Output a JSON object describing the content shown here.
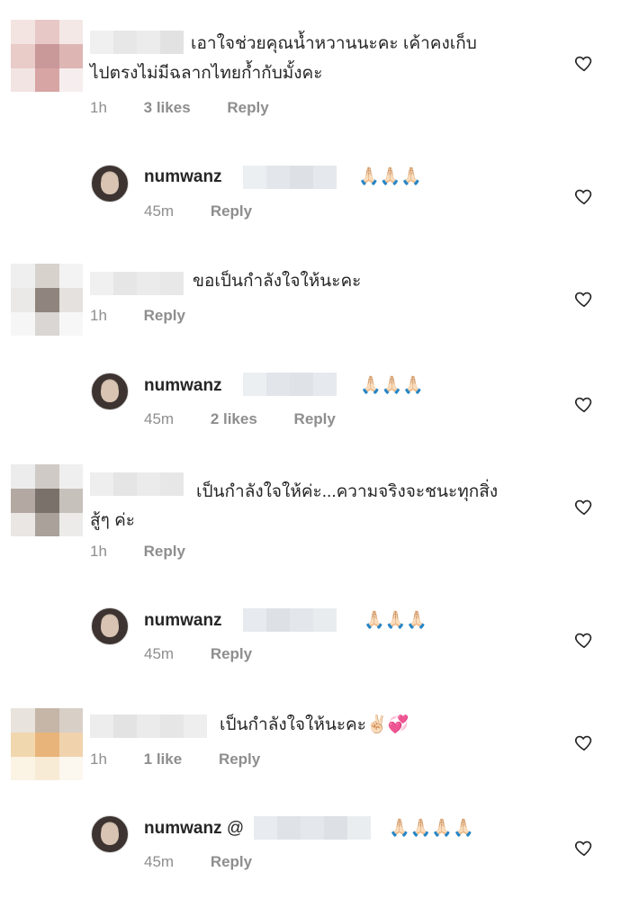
{
  "comments": [
    {
      "text_line1": "เอาใจช่วยคุณน้ำหวานนะคะ เค้าคงเก็บ",
      "text_line2": "ไปตรงไม่มีฉลากไทยก้ำกับมั้งคะ",
      "time": "1h",
      "likes": "3 likes",
      "reply": "Reply"
    },
    {
      "username": "numwanz",
      "emojis": "🙏🏻🙏🏻🙏🏻",
      "time": "45m",
      "reply": "Reply"
    },
    {
      "text_line1": "ขอเป็นกำลังใจให้นะคะ",
      "time": "1h",
      "reply": "Reply"
    },
    {
      "username": "numwanz",
      "emojis": "🙏🏻🙏🏻🙏🏻",
      "time": "45m",
      "likes": "2 likes",
      "reply": "Reply"
    },
    {
      "text_line1": "เป็นกำลังใจให้ค่ะ...ความจริงจะชนะทุกสิ่ง",
      "text_line2": "สู้ๆ ค่ะ",
      "time": "1h",
      "reply": "Reply"
    },
    {
      "username": "numwanz",
      "emojis": "🙏🏻🙏🏻🙏🏻",
      "time": "45m",
      "reply": "Reply"
    },
    {
      "text_line1": "เป็นกำลังใจให้นะคะ✌🏻💞",
      "time": "1h",
      "likes": "1 like",
      "reply": "Reply"
    },
    {
      "username": "numwanz",
      "mention_prefix": "@",
      "emojis": "🙏🏻🙏🏻🙏🏻🙏🏻",
      "time": "45m",
      "reply": "Reply"
    }
  ],
  "icons": {
    "like": "heart-outline-icon"
  },
  "colors": {
    "text": "#262626",
    "meta": "#8e8e8e",
    "background": "#ffffff"
  }
}
